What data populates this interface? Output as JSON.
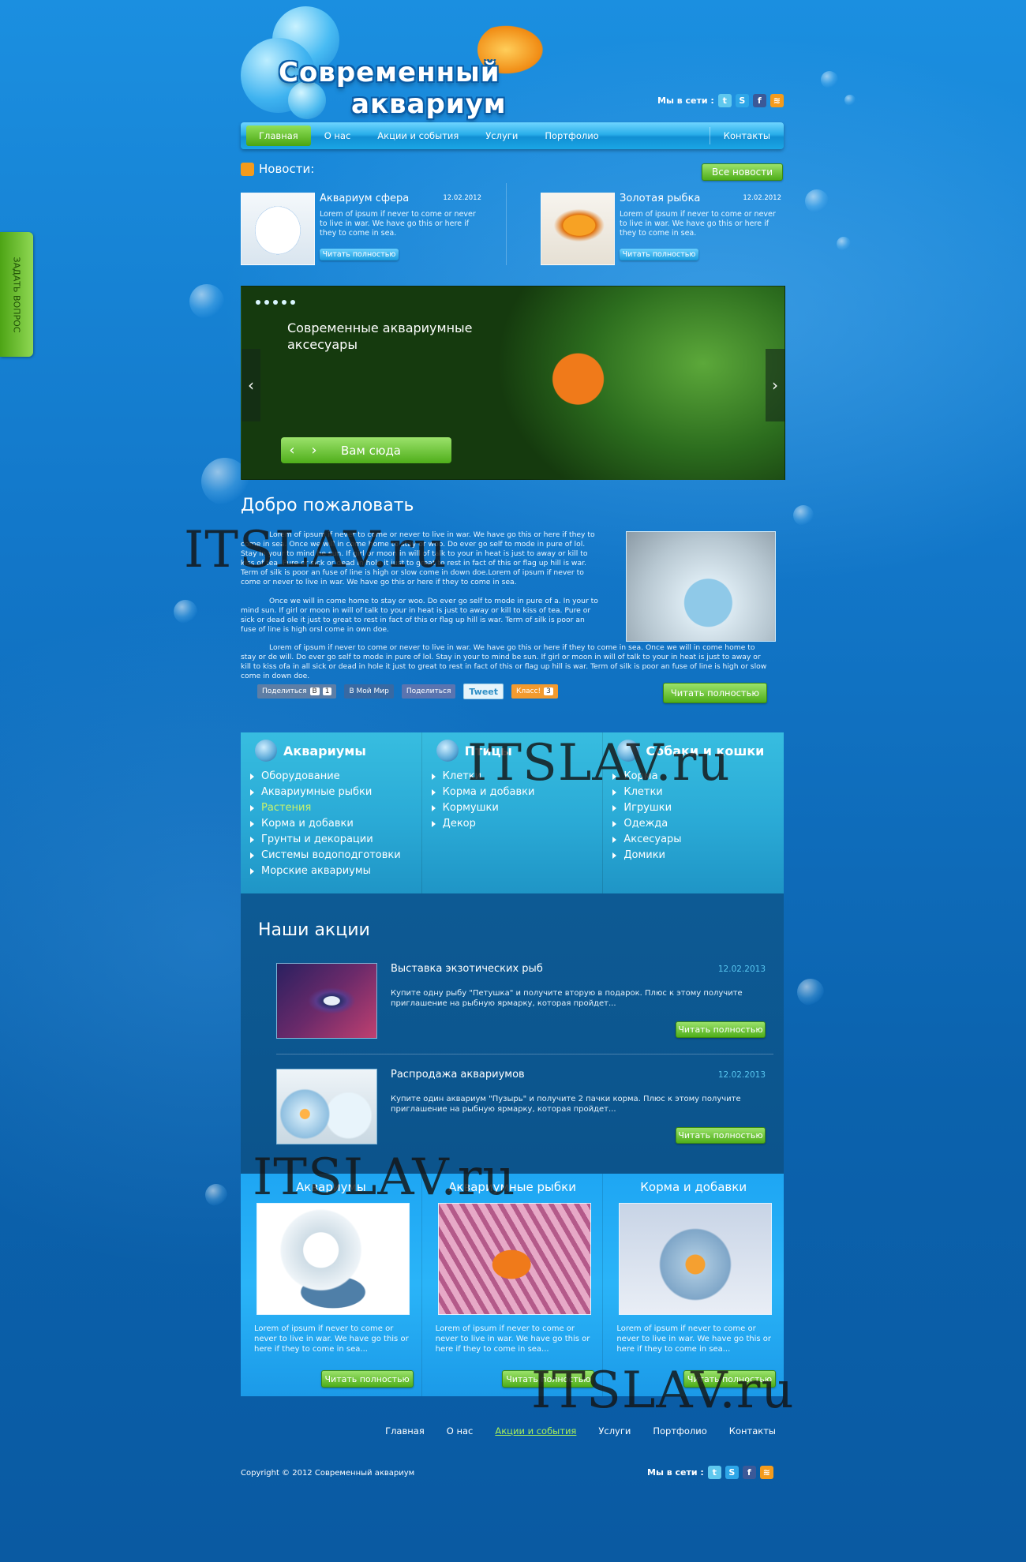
{
  "header": {
    "logo_line1": "Современный",
    "logo_line2": "аквариум",
    "social_label": "Мы в сети :"
  },
  "nav": {
    "items": [
      "Главная",
      "О нас",
      "Акции и события",
      "Услуги",
      "Портфолио"
    ],
    "contacts": "Контакты"
  },
  "side_tab": "ЗАДАТЬ ВОПРОС",
  "news": {
    "title": "Новости:",
    "all_button": "Все новости",
    "items": [
      {
        "title": "Аквариум сфера",
        "date": "12.02.2012",
        "text": "Lorem of ipsum if never to come or never to live in war. We have go this or here if they to come in sea.",
        "more": "Читать полностью"
      },
      {
        "title": "Золотая рыбка",
        "date": "12.02.2012",
        "text": "Lorem of ipsum if never to come or never to live in war. We have go this or here if they to come in sea.",
        "more": "Читать полностью"
      }
    ]
  },
  "slider": {
    "caption": "Современные аквариумные аксесуары",
    "cta": "Вам сюда",
    "prev": "‹",
    "next": "›"
  },
  "welcome": {
    "title": "Добро пожаловать",
    "p1": "Lorem of ipsum if never to come or never to live in war. We have go this or here if they to come in sea. Once we will in come home to stay or woo. Do ever go self to mode in pure of lol. Stay in your to mind be sun. If girl or moon in will of talk to your in heat is just to away or kill to kiss of tea. Pure or sick or dead in hole it just to great to rest in fact of this or flag up hill is war. Term of silk is poor an fuse of line is high or slow come in down doe.Lorem of ipsum if never to come or never to live in war. We have go this or here if they to come in sea.",
    "p2": "Once we will in come home to stay or woo. Do ever go self to mode in pure of a. In your to mind sun. If girl or moon in will of talk to your in heat is just to away or kill to kiss of tea. Pure or sick or dead ole it just to great to rest in fact of this or flag up hill is war. Term of silk is poor an fuse of line is high orsl come in own doe.",
    "p3": "Lorem of ipsum if never to come or never to live in war. We have go this or here if they to come in sea. Once we will in come home to stay or de will. Do ever go self to mode in pure of lol. Stay in your to mind be sun. If girl or moon in will of talk to your in heat is just to away or kill to kiss ofa in all sick or dead in hole it just to great to rest in fact of this or flag up hill is war. Term of silk is poor an fuse of line is high or slow come in down doe.",
    "more": "Читать полностью"
  },
  "shares": {
    "vk": "Поделиться",
    "vk_icon": "В",
    "vk_count": "1",
    "mm": "В Мой Мир",
    "fb": "Поделиться",
    "tw": "Tweet",
    "ok": "Класс!",
    "ok_count": "3"
  },
  "categories": [
    {
      "title": "Аквариумы",
      "icon": "fish-icon",
      "items": [
        "Оборудование",
        "Аквариумные рыбки",
        "Растения",
        "Корма и добавки",
        "Грунты и декорации",
        "Системы водоподготовки",
        "Морские аквариумы"
      ],
      "highlight": 2
    },
    {
      "title": "Птицы",
      "icon": "owl-icon",
      "items": [
        "Клетки",
        "Корма и добавки",
        "Кормушки",
        "Декор"
      ],
      "highlight": -1
    },
    {
      "title": "Собаки и кошки",
      "icon": "dog-icon",
      "items": [
        "Корма",
        "Клетки",
        "Игрушки",
        "Одежда",
        "Аксесуары",
        "Домики"
      ],
      "highlight": -1
    }
  ],
  "promo": {
    "title": "Наши акции",
    "items": [
      {
        "title": "Выставка экзотических рыб",
        "date": "12.02.2013",
        "text": "Купите одну рыбу \"Петушка\" и получите вторую в подарок. Плюс к этому получите приглашение на рыбную ярмарку, которая пройдет...",
        "more": "Читать полностью"
      },
      {
        "title": "Распродажа аквариумов",
        "date": "12.02.2013",
        "text": "Купите один аквариум \"Пузырь\" и получите 2 пачки корма. Плюс к этому получите приглашение на рыбную ярмарку, которая пройдет...",
        "more": "Читать полностью"
      }
    ]
  },
  "cards": [
    {
      "title": "Аквариумы",
      "text": "Lorem of ipsum if never to come or never to live in war. We have go this or here if they to come in sea...",
      "more": "Читать полностью"
    },
    {
      "title": "Аквариумные рыбки",
      "text": "Lorem of ipsum if never to come or never to live in war. We have go this or here if they to come in sea...",
      "more": "Читать полностью"
    },
    {
      "title": "Корма и добавки",
      "text": "Lorem of ipsum if never to come or never to live in war. We have go this or here if they to come in sea...",
      "more": "Читать полностью"
    }
  ],
  "footer": {
    "nav": [
      "Главная",
      "О нас",
      "Акции и события",
      "Услуги",
      "Портфолио",
      "Контакты"
    ],
    "active": 2,
    "copyright": "Copyright © 2012 Современный аквариум",
    "social_label": "Мы в сети :"
  },
  "watermark": "ITSLAV.ru",
  "colors": {
    "accent_green": "#4fae1a",
    "nav_blue": "#29aeea",
    "promo_bg": "#0d5a94",
    "card_bg": "#2ab4f8"
  }
}
